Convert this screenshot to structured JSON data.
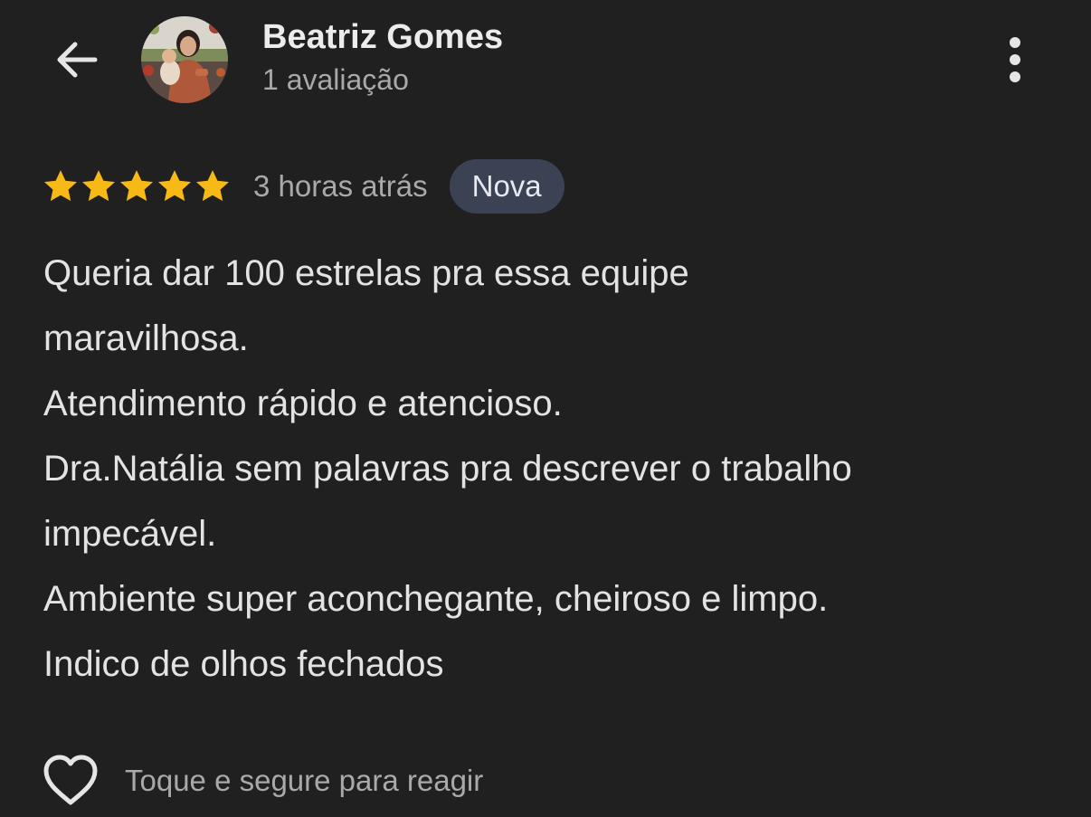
{
  "colors": {
    "background": "#202021",
    "star": "#f7b916",
    "badge_bg": "#3b4253",
    "primary_text": "#e3e3e3",
    "secondary_text": "#a9a9ab"
  },
  "header": {
    "back_icon": "arrow-left-icon",
    "author_name": "Beatriz Gomes",
    "review_count": "1 avaliação",
    "more_icon": "more-vertical-icon"
  },
  "review": {
    "rating": 5,
    "rating_max": 5,
    "time": "3 horas atrás",
    "badge": "Nova",
    "lines": [
      "Queria dar 100 estrelas pra essa equipe",
      "maravilhosa.",
      "Atendimento rápido e atencioso.",
      "Dra.Natália sem palavras pra descrever o trabalho",
      "impecável.",
      "Ambiente super aconchegante, cheiroso e limpo.",
      "Indico de olhos fechados"
    ]
  },
  "reaction": {
    "icon": "heart-outline-icon",
    "hint": "Toque e segure para reagir"
  }
}
